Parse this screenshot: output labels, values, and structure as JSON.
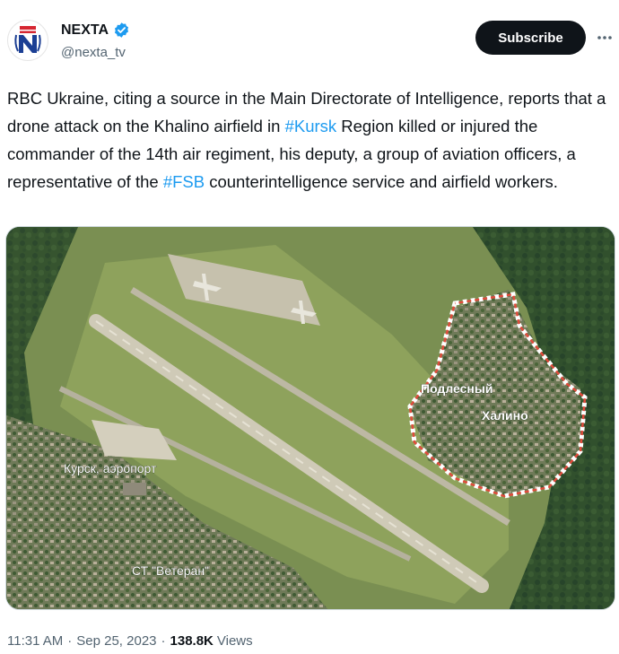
{
  "author": {
    "display_name": "NEXTA",
    "handle": "@nexta_tv",
    "verified_icon": "verified-badge-icon",
    "avatar_icon": "nexta-logo-icon"
  },
  "actions": {
    "subscribe_label": "Subscribe",
    "more_icon": "more-options-icon"
  },
  "tweet": {
    "segments": [
      "RBC Ukraine, citing a source in the Main Directorate of Intelligence, reports that a drone attack on the Khalino airfield in ",
      "#Kursk",
      " Region killed or injured the commander of the 14th air regiment, his deputy, a group of aviation officers, a representative of the ",
      "#FSB",
      " counterintelligence service and airfield workers."
    ]
  },
  "media": {
    "labels": {
      "podlesny": "Подлесный",
      "khalino": "Халино",
      "airport": "Курск, аэропорт",
      "veteran": "СТ \"Ветеран\""
    }
  },
  "meta": {
    "time": "11:31 AM",
    "date": "Sep 25, 2023",
    "separator": "·",
    "views_count": "138.8K",
    "views_label": "Views"
  },
  "colors": {
    "text": "#0f1419",
    "secondary": "#536471",
    "link": "#1d9bf0",
    "verified": "#1d9bf0",
    "button_bg": "#0f1419",
    "brand_red": "#d62631"
  }
}
